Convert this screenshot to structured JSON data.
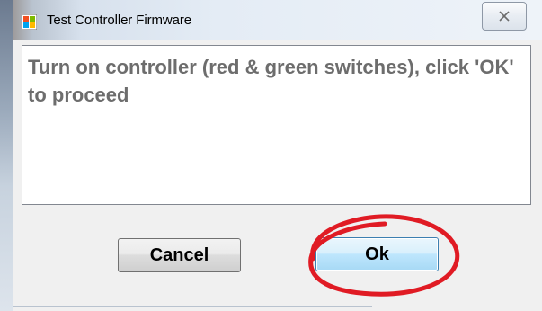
{
  "window": {
    "title": "Test Controller Firmware",
    "close_label": "close"
  },
  "message": {
    "text": "Turn on controller (red & green switches), click 'OK' to proceed"
  },
  "buttons": {
    "cancel_label": "Cancel",
    "ok_label": "Ok"
  },
  "icons": {
    "app": "app-windows-icon",
    "close": "close-x-icon"
  },
  "colors": {
    "annotation_circle": "#e01b24",
    "ok_button_border": "#3c7fb1",
    "message_text": "#6d6d6d"
  }
}
